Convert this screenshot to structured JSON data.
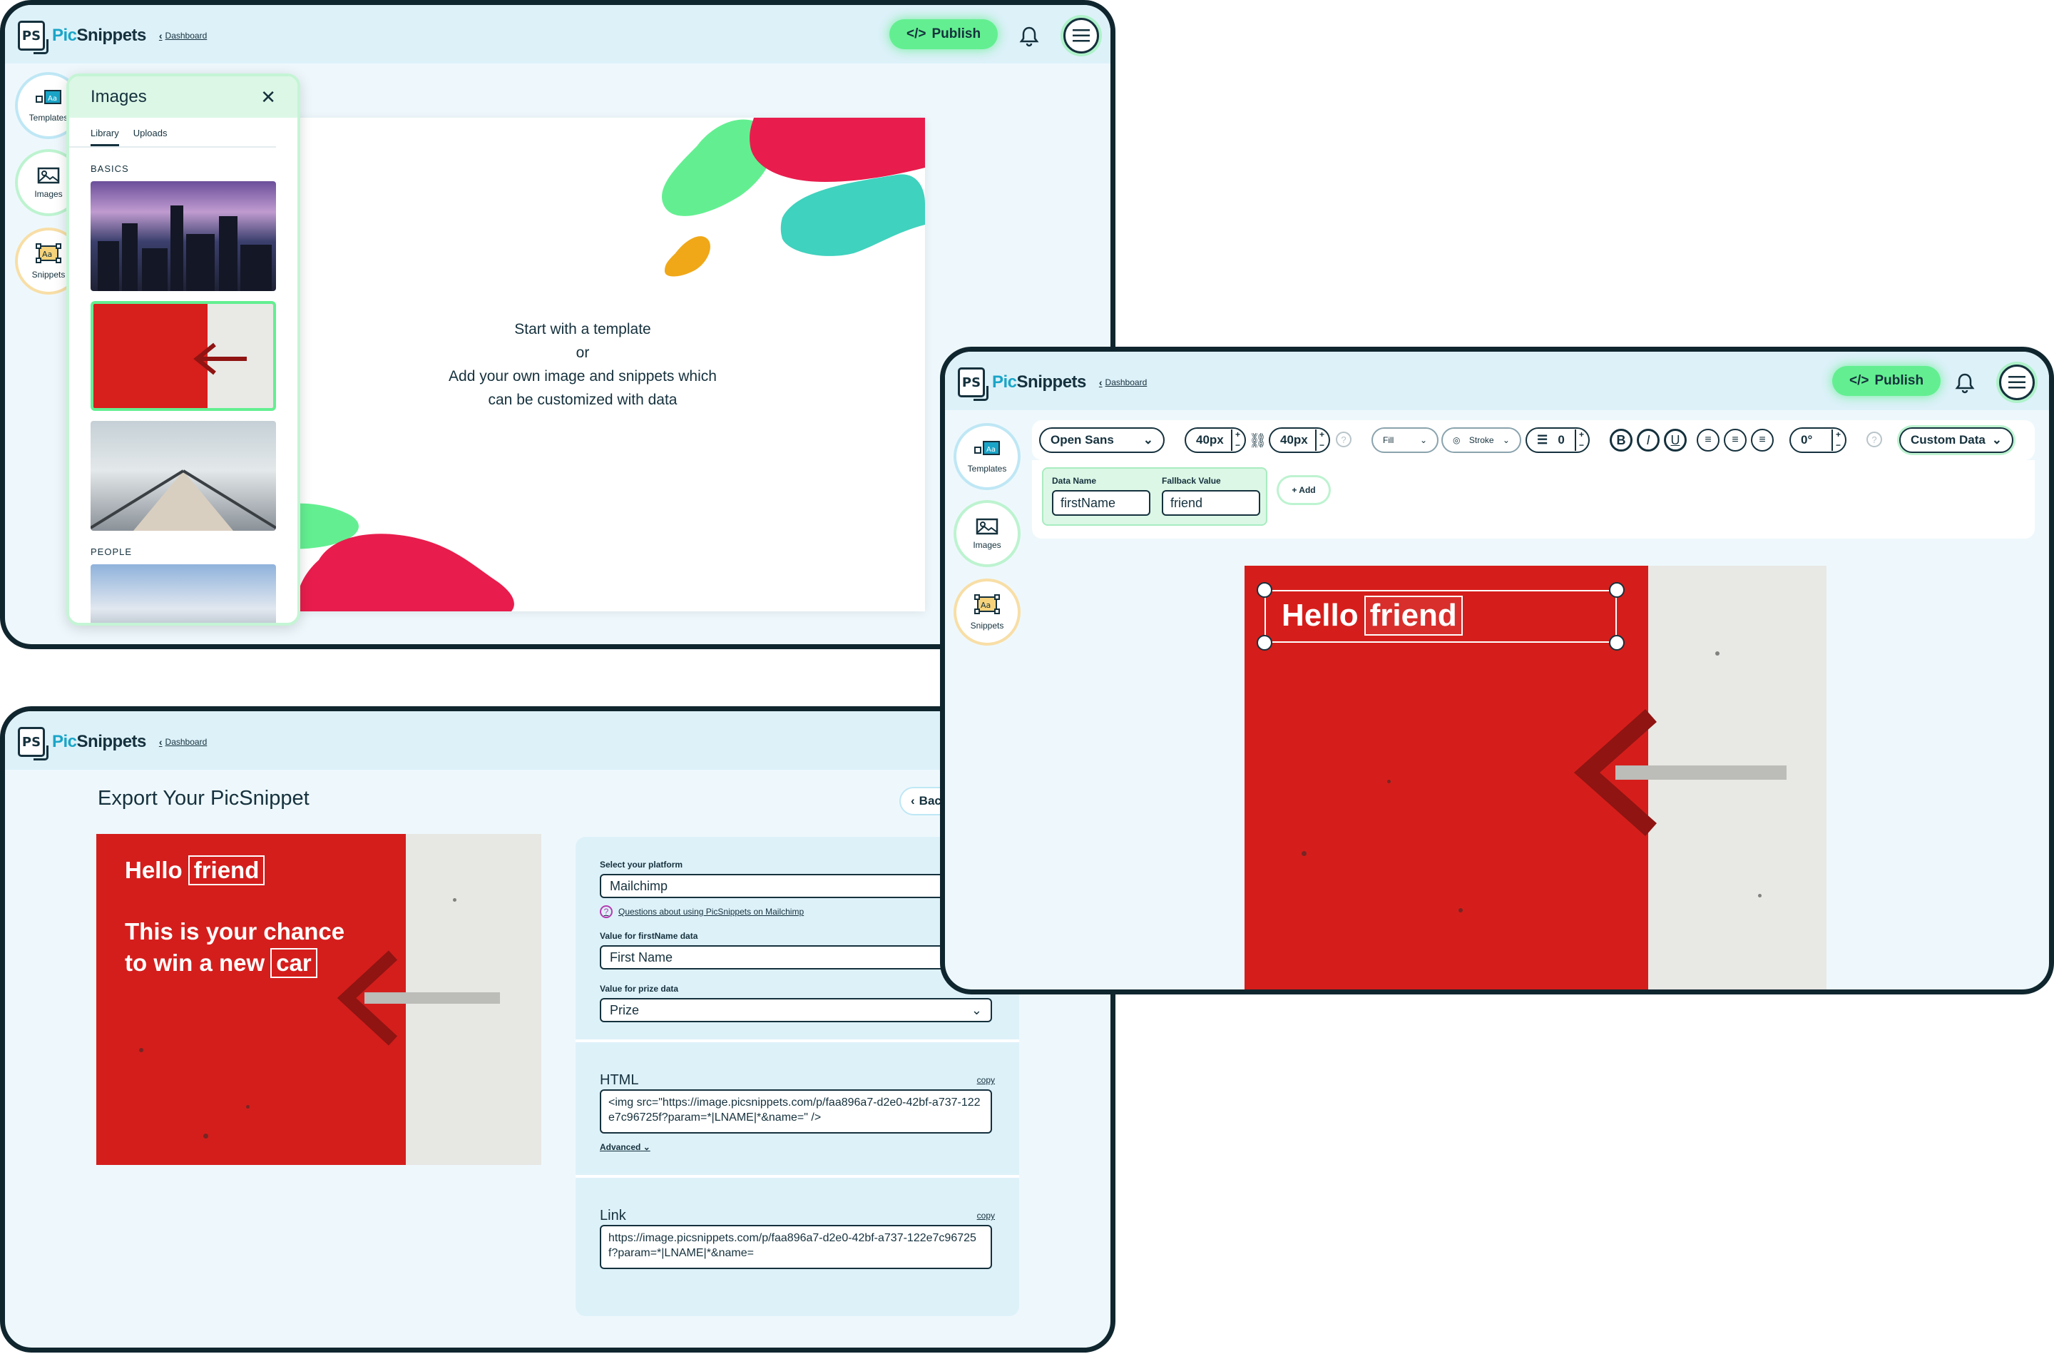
{
  "brand": {
    "logo_mark": "PS",
    "name_part1": "Pic",
    "name_part2": "Snippets",
    "breadcrumb": "Dashboard"
  },
  "header": {
    "publish_label": "Publish"
  },
  "rail": {
    "templates": "Templates",
    "images": "Images",
    "snippets": "Snippets"
  },
  "images_panel": {
    "title": "Images",
    "tabs": [
      "Library",
      "Uploads"
    ],
    "sections": {
      "basics": "BASICS",
      "people": "PEOPLE"
    }
  },
  "canvas": {
    "line1": "Start with a template",
    "line2": "or",
    "line3": "Add your own image and snippets which",
    "line4": "can be customized with data"
  },
  "export": {
    "title": "Export Your PicSnippet",
    "back": "Back",
    "preview": {
      "hello": "Hello",
      "friend": "friend",
      "line2": "This is your chance",
      "line3": "to win a new",
      "car": "car"
    },
    "platform_label": "Select your platform",
    "platform_value": "Mailchimp",
    "help_link": "Questions about using PicSnippets on Mailchimp",
    "firstname_label": "Value for firstName data",
    "firstname_value": "First Name",
    "prize_label": "Value for prize data",
    "prize_value": "Prize",
    "html_title": "HTML",
    "html_code": "<img src=\"https://image.picsnippets.com/p/faa896a7-d2e0-42bf-a737-122e7c96725f?param=*|LNAME|*&name=\" />",
    "advanced": "Advanced",
    "link_title": "Link",
    "link_value": "https://image.picsnippets.com/p/faa896a7-d2e0-42bf-a737-122e7c96725f?param=*|LNAME|*&name=",
    "copy": "copy"
  },
  "editor": {
    "font": "Open Sans",
    "size1": "40px",
    "size2": "40px",
    "fill": "Fill",
    "stroke": "Stroke",
    "stroke_value": "0",
    "bold": "B",
    "italic": "I",
    "underline": "U",
    "rotation": "0°",
    "custom_data": "Custom Data",
    "data_name_label": "Data Name",
    "data_name_value": "firstName",
    "fallback_label": "Fallback Value",
    "fallback_value": "friend",
    "add": "+ Add",
    "hello": "Hello",
    "friend": "friend"
  },
  "colors": {
    "accent_green": "#63ef91",
    "brand_blue": "#1aa5c8",
    "ink": "#15313d",
    "red": "#d51e1b",
    "teal": "#3fd2be",
    "pink": "#e81d4d",
    "amber": "#f0a818"
  }
}
